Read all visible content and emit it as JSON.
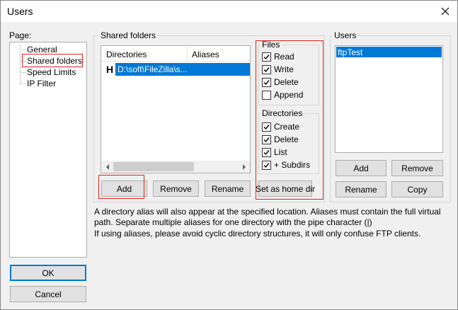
{
  "window": {
    "title": "Users"
  },
  "page_panel": {
    "label": "Page:",
    "items": [
      {
        "label": "General"
      },
      {
        "label": "Shared folders"
      },
      {
        "label": "Speed Limits"
      },
      {
        "label": "IP Filter"
      }
    ]
  },
  "shared_folders": {
    "group_label": "Shared folders",
    "columns": {
      "directories": "Directories",
      "aliases": "Aliases"
    },
    "rows": [
      {
        "marker": "H",
        "directory": "D:\\soft\\FileZilla\\s..."
      }
    ],
    "buttons": {
      "add": "Add",
      "remove": "Remove",
      "rename": "Rename",
      "set_home": "Set as home dir"
    }
  },
  "files": {
    "group_label": "Files",
    "read": "Read",
    "write": "Write",
    "delete": "Delete",
    "append": "Append"
  },
  "directories": {
    "group_label": "Directories",
    "create": "Create",
    "delete": "Delete",
    "list": "List",
    "subdirs": "+ Subdirs"
  },
  "users": {
    "group_label": "Users",
    "items": [
      "ftpTest"
    ],
    "buttons": {
      "add": "Add",
      "remove": "Remove",
      "rename": "Rename",
      "copy": "Copy"
    }
  },
  "info": {
    "line1": "A directory alias will also appear at the specified location. Aliases must contain the full virtual",
    "line2": "path. Separate multiple aliases for one directory with the pipe character (|)",
    "line3": "If using aliases, please avoid cyclic directory structures, it will only confuse FTP clients."
  },
  "dialog_buttons": {
    "ok": "OK",
    "cancel": "Cancel"
  }
}
